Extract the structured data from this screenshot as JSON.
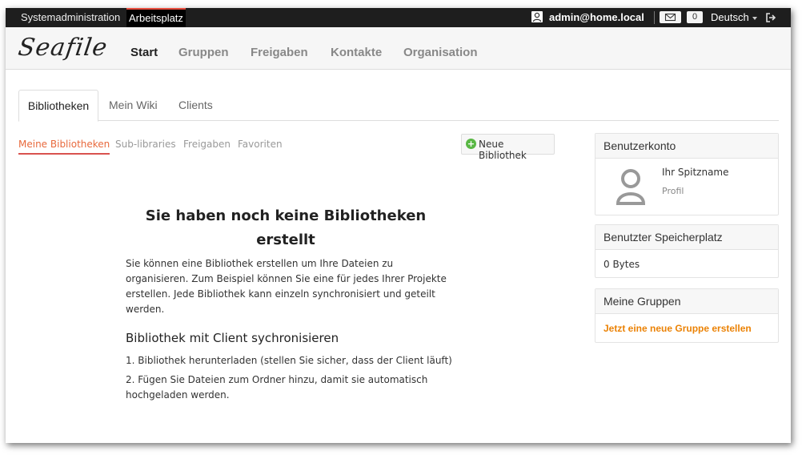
{
  "topbar": {
    "sysadmin": "Systemadministration",
    "workspace": "Arbeitsplatz",
    "user": "admin@home.local",
    "notification_count": "0",
    "language": "Deutsch"
  },
  "header": {
    "logo": "Seafile",
    "nav": [
      "Start",
      "Gruppen",
      "Freigaben",
      "Kontakte",
      "Organisation"
    ]
  },
  "tabs": [
    "Bibliotheken",
    "Mein Wiki",
    "Clients"
  ],
  "subtabs": [
    "Meine Bibliotheken",
    "Sub-libraries",
    "Freigaben",
    "Favoriten"
  ],
  "new_library_button": "Neue Bibliothek",
  "empty_state": {
    "title": "Sie haben noch keine Bibliotheken erstellt",
    "text": "Sie können eine Bibliothek erstellen um Ihre Dateien zu organisieren. Zum Beispiel können Sie eine für jedes Ihrer Projekte erstellen. Jede Bibliothek kann einzeln synchronisiert und geteilt werden.",
    "subtitle": "Bibliothek mit Client sychronisieren",
    "steps": [
      "1. Bibliothek herunterladen (stellen Sie sicher, dass der Client läuft)",
      "2. Fügen Sie Dateien zum Ordner hinzu, damit sie automatisch hochgeladen werden."
    ]
  },
  "sidebar": {
    "account": {
      "title": "Benutzerkonto",
      "nickname": "Ihr Spitzname",
      "profile": "Profil"
    },
    "storage": {
      "title": "Benutzter Speicherplatz",
      "value": "0 Bytes"
    },
    "groups": {
      "title": "Meine Gruppen",
      "create_link": "Jetzt eine neue Gruppe erstellen"
    }
  },
  "colors": {
    "accent": "#eb8205",
    "active_underline": "#d9534f",
    "topbar": "#1e1e1e"
  }
}
